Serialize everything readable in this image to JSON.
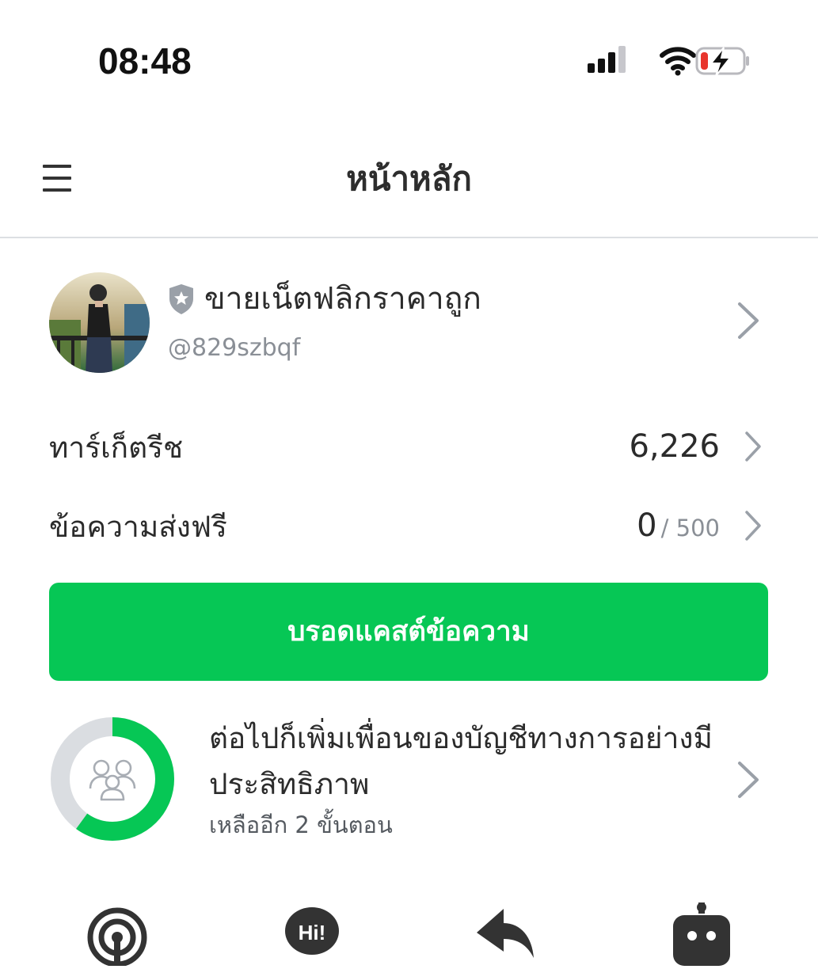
{
  "status_bar": {
    "time": "08:48",
    "signal_icon": "cellular-signal-icon",
    "wifi_icon": "wifi-icon",
    "battery_icon": "battery-charging-low-icon"
  },
  "header": {
    "menu_icon": "hamburger-menu-icon",
    "title": "หน้าหลัก"
  },
  "account": {
    "name": "ขายเน็ตฟลิกราคาถูก",
    "id": "@829szbqf",
    "badge_icon": "shield-star-icon"
  },
  "stats": {
    "target_reach_label": "ทาร์เก็ตรีช",
    "target_reach_value": "6,226",
    "free_messages_label": "ข้อความส่งฟรี",
    "free_messages_used": "0",
    "free_messages_limit": "/ 500"
  },
  "broadcast_button": {
    "label": "บรอดแคสต์ข้อความ"
  },
  "growth_card": {
    "title": "ต่อไปก็เพิ่มเพื่อนของบัญชีทางการอย่างมีประสิทธิภาพ",
    "subtitle": "เหลืออีก 2 ขั้นตอน",
    "progress_fraction": 0.6
  },
  "shortcuts": [
    "broadcast-signal-icon",
    "greeting-hi-icon",
    "reply-icon",
    "bot-icon"
  ],
  "colors": {
    "accent_green": "#06C755",
    "ring_track": "#DADDE1",
    "battery_low": "#E8352D"
  }
}
